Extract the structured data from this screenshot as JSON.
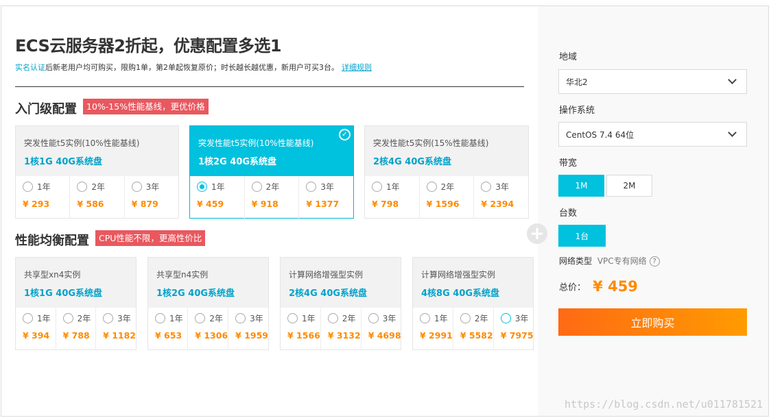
{
  "header": {
    "title": "ECS云服务器2折起，优惠配置多选1",
    "sub_blue": "实名认证",
    "sub_text": "后新老用户均可购买，限购1单，第2单起恢复原价；时长越长越优惠，新用户可买3台。",
    "sub_link": "详细规则"
  },
  "sections": [
    {
      "title": "入门级配置",
      "badge": "10%-15%性能基线，更优价格",
      "cards": [
        {
          "name": "突发性能t5实例(10%性能基线)",
          "spec": "1核1G 40G系统盘",
          "selected": false,
          "options": [
            {
              "year": "1年",
              "price": "¥ 293"
            },
            {
              "year": "2年",
              "price": "¥ 586"
            },
            {
              "year": "3年",
              "price": "¥ 879"
            }
          ]
        },
        {
          "name": "突发性能t5实例(10%性能基线)",
          "spec": "1核2G 40G系统盘",
          "selected": true,
          "options": [
            {
              "year": "1年",
              "price": "¥ 459",
              "checked": true
            },
            {
              "year": "2年",
              "price": "¥ 918"
            },
            {
              "year": "3年",
              "price": "¥ 1377"
            }
          ]
        },
        {
          "name": "突发性能t5实例(15%性能基线)",
          "spec": "2核4G 40G系统盘",
          "selected": false,
          "options": [
            {
              "year": "1年",
              "price": "¥ 798"
            },
            {
              "year": "2年",
              "price": "¥ 1596"
            },
            {
              "year": "3年",
              "price": "¥ 2394"
            }
          ]
        }
      ]
    },
    {
      "title": "性能均衡配置",
      "badge": "CPU性能不限，更高性价比",
      "cards": [
        {
          "name": "共享型xn4实例",
          "spec": "1核1G 40G系统盘",
          "selected": false,
          "options": [
            {
              "year": "1年",
              "price": "¥ 394"
            },
            {
              "year": "2年",
              "price": "¥ 788"
            },
            {
              "year": "3年",
              "price": "¥ 1182"
            }
          ]
        },
        {
          "name": "共享型n4实例",
          "spec": "1核2G 40G系统盘",
          "selected": false,
          "options": [
            {
              "year": "1年",
              "price": "¥ 653"
            },
            {
              "year": "2年",
              "price": "¥ 1306"
            },
            {
              "year": "3年",
              "price": "¥ 1959"
            }
          ]
        },
        {
          "name": "计算网络增强型实例",
          "spec": "2核4G 40G系统盘",
          "selected": false,
          "options": [
            {
              "year": "1年",
              "price": "¥ 1566"
            },
            {
              "year": "2年",
              "price": "¥ 3132"
            },
            {
              "year": "3年",
              "price": "¥ 4698"
            }
          ]
        },
        {
          "name": "计算网络增强型实例",
          "spec": "4核8G 40G系统盘",
          "selected": false,
          "options": [
            {
              "year": "1年",
              "price": "¥ 2991"
            },
            {
              "year": "2年",
              "price": "¥ 5582"
            },
            {
              "year": "3年",
              "price": "¥ 7975",
              "hover": true
            }
          ]
        }
      ]
    }
  ],
  "config": {
    "region_label": "地域",
    "region_value": "华北2",
    "os_label": "操作系统",
    "os_value": "CentOS 7.4 64位",
    "bandwidth_label": "带宽",
    "bandwidth_options": [
      "1M",
      "2M"
    ],
    "bandwidth_selected": "1M",
    "count_label": "台数",
    "count_value": "1台",
    "network_label": "网络类型",
    "network_value": "VPC专有网络",
    "help_glyph": "?",
    "total_label": "总价：",
    "total_value": "¥ 459",
    "buy_label": "立即购买"
  },
  "watermark": "https://blog.csdn.net/u011781521",
  "colors": {
    "accent": "#00c1de",
    "price": "#ff8a00",
    "badge": "#e9585f",
    "buy_start": "#ff6a14",
    "buy_end": "#ff9b00"
  },
  "icons": {
    "check": "✓",
    "plus": "+"
  }
}
